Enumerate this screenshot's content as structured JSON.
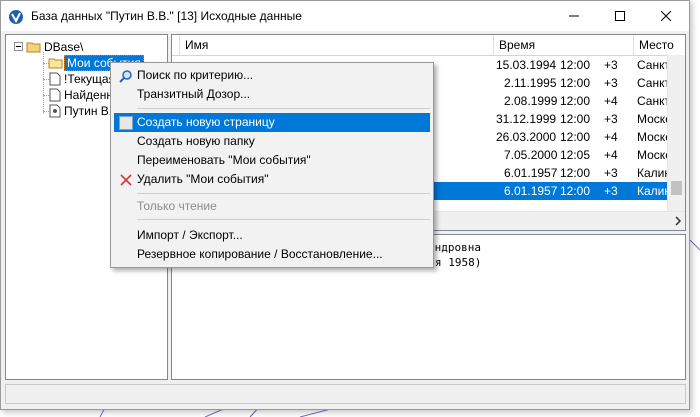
{
  "window": {
    "title": "База данных \"Путин В.В.\"  [13]  Исходные данные"
  },
  "tree": {
    "root": "DBase\\",
    "items": [
      {
        "label": "Мои события"
      },
      {
        "label": "!Текущая"
      },
      {
        "label": "Найденн"
      },
      {
        "label": "Путин В.В"
      }
    ]
  },
  "table": {
    "columns": [
      "Имя",
      "Время",
      "Место"
    ],
    "rows": [
      {
        "name": "",
        "date": "15.03.1994",
        "time": "12:00",
        "tz": "+3",
        "place": "Санкт"
      },
      {
        "name": "",
        "date": "2.11.1995",
        "time": "12:00",
        "tz": "+3",
        "place": "Санкт"
      },
      {
        "name": "",
        "date": "2.08.1999",
        "time": "12:00",
        "tz": "+4",
        "place": "Санкт"
      },
      {
        "name": "",
        "date": "31.12.1999",
        "time": "12:00",
        "tz": "+3",
        "place": "Моске"
      },
      {
        "name": "",
        "date": "26.03.2000",
        "time": "12:00",
        "tz": "+4",
        "place": "Моске"
      },
      {
        "name": "",
        "date": "7.05.2000",
        "time": "12:05",
        "tz": "+4",
        "place": "Моске"
      },
      {
        "name": "",
        "date": "6.01.1957",
        "time": "12:00",
        "tz": "+3",
        "place": "Калин"
      },
      {
        "name": "",
        "date": "6.01.1957",
        "time": "12:00",
        "tz": "+3",
        "place": "Калин"
      }
    ]
  },
  "detail": {
    "lines": [
      "андровна",
      "я 1958)"
    ]
  },
  "context_menu": {
    "items": [
      {
        "label": "Поиск по критерию...",
        "icon": "magnifier-icon"
      },
      {
        "label": "Транзитный Дозор..."
      },
      {
        "label": "Создать новую страницу"
      },
      {
        "label": "Создать новую папку"
      },
      {
        "label": "Переименовать \"Мои события\""
      },
      {
        "label": "Удалить \"Мои события\"",
        "icon": "delete-x-icon"
      },
      {
        "label": "Только чтение"
      },
      {
        "label": "Импорт / Экспорт..."
      },
      {
        "label": "Резервное копирование / Восстановление..."
      }
    ]
  },
  "colors": {
    "selection": "#0078d7",
    "delete_icon": "#d9303b"
  }
}
